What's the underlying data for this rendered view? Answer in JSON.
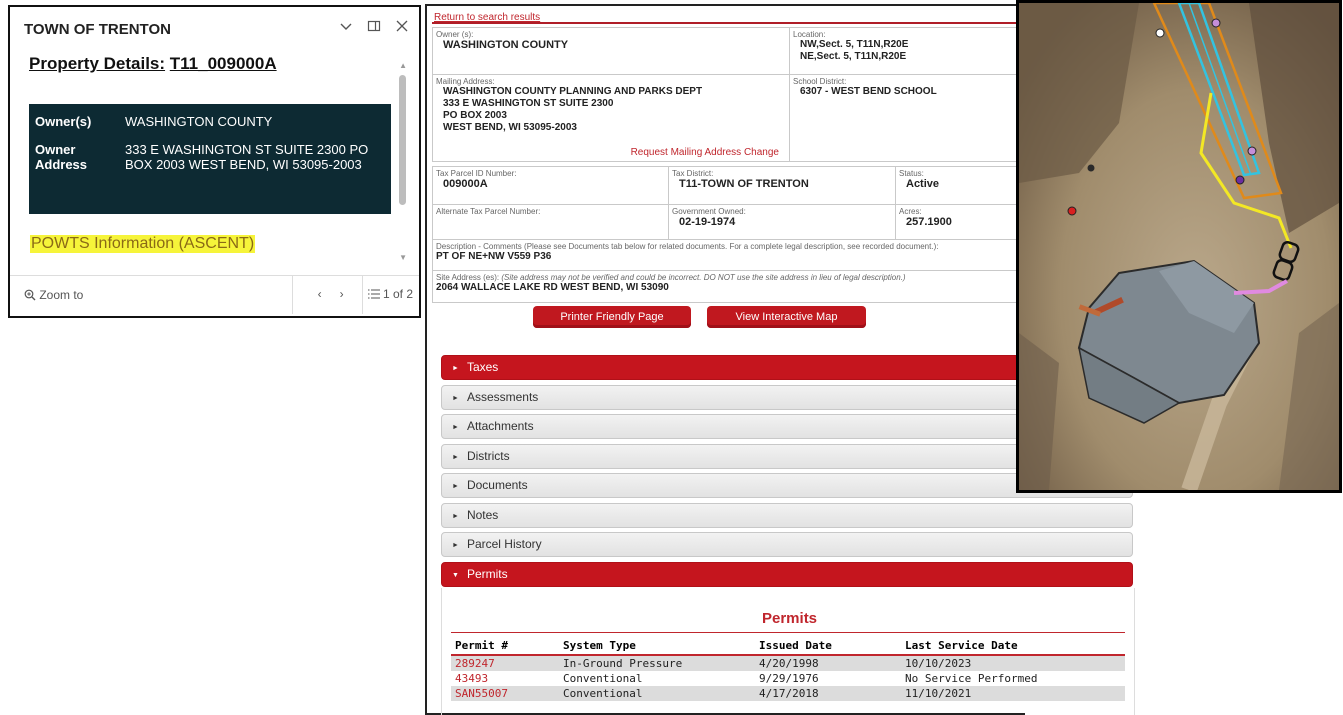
{
  "popup": {
    "title": "TOWN OF TRENTON",
    "icons": {
      "collapse": "chevron-down-icon",
      "dock": "dock-icon",
      "close": "close-icon"
    },
    "subtitle_label": "Property Details:",
    "subtitle_value": "T11_009000A",
    "owner_label": "Owner(s)",
    "owner_value": "WASHINGTON COUNTY",
    "address_label": "Owner Address",
    "address_value": "333 E WASHINGTON ST SUITE 2300 PO BOX 2003 WEST BEND, WI 53095-2003",
    "posts_link": "POWTS Information (ASCENT)",
    "zoom_label": "Zoom to",
    "page_indicator": "1 of 2"
  },
  "panel": {
    "return_link": "Return to search results",
    "owners_label": "Owner (s):",
    "owners_value": "WASHINGTON COUNTY",
    "location_label": "Location:",
    "location_line1": "NW,Sect. 5, T11N,R20E",
    "location_line2": "NE,Sect. 5, T11N,R20E",
    "mailing_label": "Mailing Address:",
    "mailing_line1": "WASHINGTON COUNTY PLANNING AND PARKS DEPT",
    "mailing_line2": "333 E WASHINGTON ST SUITE 2300",
    "mailing_line3": "PO BOX 2003",
    "mailing_line4": "WEST BEND, WI 53095-2003",
    "request_change": "Request Mailing Address Change",
    "school_label": "School District:",
    "school_value": "6307 - WEST BEND SCHOOL",
    "taxparcel_label": "Tax Parcel ID Number:",
    "taxparcel_value": "009000A",
    "taxdistrict_label": "Tax District:",
    "taxdistrict_value": "T11-TOWN OF TRENTON",
    "status_label": "Status:",
    "status_value": "Active",
    "alt_label": "Alternate Tax Parcel Number:",
    "gov_label": "Government Owned:",
    "gov_value": "02-19-1974",
    "acres_label": "Acres:",
    "acres_value": "257.1900",
    "desc_label": "Description - Comments (Please see Documents tab below for related documents. For a complete legal description, see recorded document.):",
    "desc_value": "PT OF NE+NW V559 P36",
    "site_label": "Site Address (es):",
    "site_note": "(Site address may not be verified and could be incorrect. DO NOT use the site address in lieu of legal description.)",
    "site_value": "2064 WALLACE LAKE RD WEST BEND, WI 53090",
    "btn_print": "Printer Friendly Page",
    "btn_map": "View Interactive Map"
  },
  "accordion": [
    "Taxes",
    "Assessments",
    "Attachments",
    "Districts",
    "Documents",
    "Notes",
    "Parcel History",
    "Permits"
  ],
  "permits": {
    "title": "Permits",
    "headers": [
      "Permit #",
      "System Type",
      "Issued Date",
      "Last Service Date"
    ],
    "rows": [
      {
        "permit": "289247",
        "type": "In-Ground Pressure",
        "issued": "4/20/1998",
        "service": "10/10/2023"
      },
      {
        "permit": "43493",
        "type": "Conventional",
        "issued": "9/29/1976",
        "service": "No Service Performed"
      },
      {
        "permit": "SAN55007",
        "type": "Conventional",
        "issued": "4/17/2018",
        "service": "11/10/2021"
      }
    ]
  },
  "colors": {
    "brand_red": "#c5151e",
    "popup_dark": "#0d2a33",
    "highlight": "#f6f43a"
  }
}
